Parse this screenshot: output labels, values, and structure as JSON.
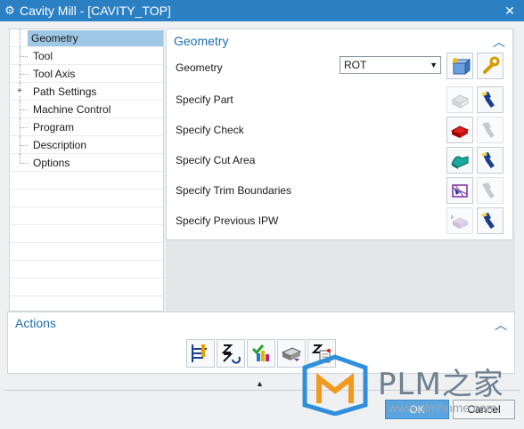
{
  "window": {
    "title": "Cavity Mill - [CAVITY_TOP]",
    "app_icon": "gear-icon",
    "close_icon": "close-icon"
  },
  "nav": {
    "items": [
      {
        "label": "Geometry",
        "selected": true,
        "expandable": false
      },
      {
        "label": "Tool",
        "selected": false,
        "expandable": false
      },
      {
        "label": "Tool Axis",
        "selected": false,
        "expandable": false
      },
      {
        "label": "Path Settings",
        "selected": false,
        "expandable": true
      },
      {
        "label": "Machine Control",
        "selected": false,
        "expandable": false
      },
      {
        "label": "Program",
        "selected": false,
        "expandable": false
      },
      {
        "label": "Description",
        "selected": false,
        "expandable": false
      },
      {
        "label": "Options",
        "selected": false,
        "expandable": false
      }
    ]
  },
  "geometry": {
    "title": "Geometry",
    "geometry_label": "Geometry",
    "geometry_value": "ROT",
    "rows": [
      {
        "label": "Specify Part"
      },
      {
        "label": "Specify Check"
      },
      {
        "label": "Specify Cut Area"
      },
      {
        "label": "Specify Trim Boundaries"
      },
      {
        "label": "Specify Previous IPW"
      }
    ]
  },
  "actions": {
    "title": "Actions"
  },
  "buttons": {
    "ok": "OK",
    "cancel": "Cancel"
  },
  "watermark": {
    "brand": "PLM之家",
    "url": "www.plmhome.com"
  },
  "colors": {
    "titlebar": "#2b7fc3",
    "accent": "#1f6fae",
    "selection": "#9fc7e6"
  }
}
